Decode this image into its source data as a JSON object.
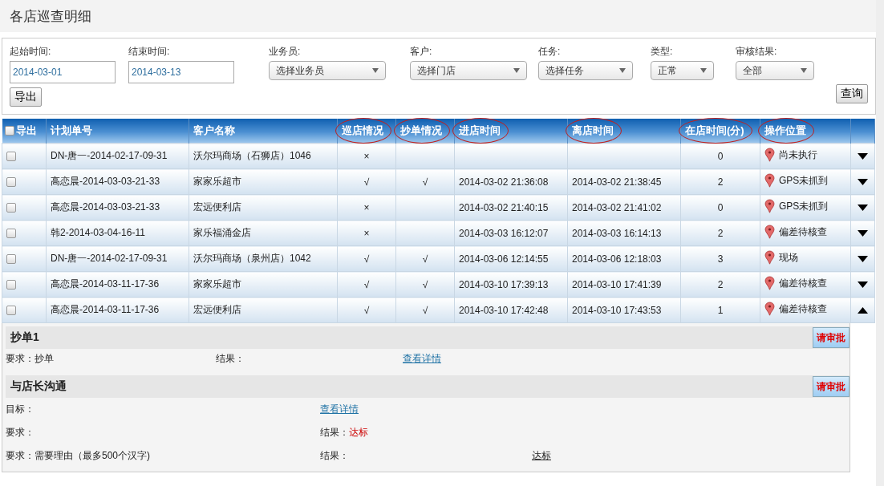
{
  "page": {
    "title": "各店巡查明细"
  },
  "filters": {
    "fields": [
      {
        "kind": "date",
        "label": "起始时间:",
        "value": "2014-03-01"
      },
      {
        "kind": "date",
        "label": "结束时间:",
        "value": "2014-03-13"
      },
      {
        "kind": "select",
        "label": "业务员:",
        "value": "选择业务员"
      },
      {
        "kind": "select",
        "label": "客户:",
        "value": "选择门店"
      },
      {
        "kind": "select",
        "label": "任务:",
        "value": "选择任务"
      },
      {
        "kind": "select",
        "label": "类型:",
        "value": "正常"
      },
      {
        "kind": "select",
        "label": "审核结果:",
        "value": "全部"
      }
    ],
    "export_button": "导出",
    "query_button": "查询"
  },
  "table": {
    "select_all": {
      "label": "导出",
      "checked": false
    },
    "columns": [
      {
        "label": "计划单号",
        "circled": false
      },
      {
        "label": "客户名称",
        "circled": false
      },
      {
        "label": "巡店情况",
        "circled": true
      },
      {
        "label": "抄单情况",
        "circled": true
      },
      {
        "label": "进店时间",
        "circled": true
      },
      {
        "label": "离店时间",
        "circled": true
      },
      {
        "label": "在店时间(分)",
        "circled": true
      },
      {
        "label": "操作位置",
        "circled": true
      }
    ],
    "rows": [
      {
        "checked": false,
        "plan": "DN-唐一-2014-02-17-09-31",
        "customer": "沃尔玛商场（石狮店）1046",
        "patrol": "×",
        "order": "",
        "enter": "",
        "leave": "",
        "minutes": "0",
        "location": "尚未执行",
        "expanded": false
      },
      {
        "checked": false,
        "plan": "高恋晨-2014-03-03-21-33",
        "customer": "家家乐超市",
        "patrol": "√",
        "order": "√",
        "enter": "2014-03-02 21:36:08",
        "leave": "2014-03-02 21:38:45",
        "minutes": "2",
        "location": "GPS未抓到",
        "expanded": false
      },
      {
        "checked": false,
        "plan": "高恋晨-2014-03-03-21-33",
        "customer": "宏远便利店",
        "patrol": "×",
        "order": "",
        "enter": "2014-03-02 21:40:15",
        "leave": "2014-03-02 21:41:02",
        "minutes": "0",
        "location": "GPS未抓到",
        "expanded": false
      },
      {
        "checked": false,
        "plan": "韩2-2014-03-04-16-11",
        "customer": "家乐福涌金店",
        "patrol": "×",
        "order": "",
        "enter": "2014-03-03 16:12:07",
        "leave": "2014-03-03 16:14:13",
        "minutes": "2",
        "location": "偏差待核查",
        "expanded": false
      },
      {
        "checked": false,
        "plan": "DN-唐一-2014-02-17-09-31",
        "customer": "沃尔玛商场（泉州店）1042",
        "patrol": "√",
        "order": "√",
        "enter": "2014-03-06 12:14:55",
        "leave": "2014-03-06 12:18:03",
        "minutes": "3",
        "location": "现场",
        "expanded": false
      },
      {
        "checked": false,
        "plan": "高恋晨-2014-03-11-17-36",
        "customer": "家家乐超市",
        "patrol": "√",
        "order": "√",
        "enter": "2014-03-10 17:39:13",
        "leave": "2014-03-10 17:41:39",
        "minutes": "2",
        "location": "偏差待核查",
        "expanded": false
      },
      {
        "checked": false,
        "plan": "高恋晨-2014-03-11-17-36",
        "customer": "宏远便利店",
        "patrol": "√",
        "order": "√",
        "enter": "2014-03-10 17:42:48",
        "leave": "2014-03-10 17:43:53",
        "minutes": "1",
        "location": "偏差待核查",
        "expanded": true
      }
    ]
  },
  "details": [
    {
      "title": "抄单1",
      "button": "请审批",
      "rows": [
        [
          {
            "kind": "text",
            "text": "要求：抄单"
          },
          {
            "kind": "text",
            "text": "结果："
          },
          {
            "kind": "link",
            "text": "查看详情"
          }
        ]
      ]
    },
    {
      "title": "与店长沟通",
      "button": "请审批",
      "rows": [
        [
          {
            "kind": "text",
            "text": "目标："
          },
          {
            "kind": "link",
            "text": "查看详情"
          }
        ],
        [
          {
            "kind": "text",
            "text": "要求："
          },
          {
            "kind": "result",
            "label": "结果：",
            "value": "达标"
          }
        ],
        [
          {
            "kind": "text",
            "text": "要求：需要理由（最多500个汉字)"
          },
          {
            "kind": "text",
            "text": "结果："
          },
          {
            "kind": "underlined",
            "text": "达标"
          }
        ]
      ]
    }
  ]
}
